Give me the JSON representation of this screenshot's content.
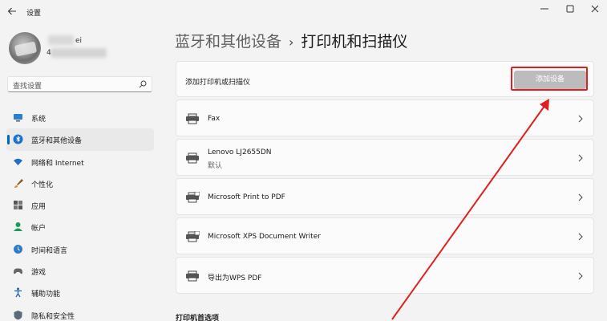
{
  "window": {
    "title": "设置",
    "back_icon": "arrow-left-icon",
    "minimize_icon": "minimize-icon",
    "maximize_icon": "maximize-icon",
    "close_icon": "close-icon"
  },
  "user": {
    "name_suffix": "ei",
    "email_prefix": "4"
  },
  "search": {
    "placeholder": "查找设置",
    "icon": "search-icon"
  },
  "nav": {
    "items": [
      {
        "label": "系统",
        "icon": "monitor-icon"
      },
      {
        "label": "蓝牙和其他设备",
        "icon": "bluetooth-icon"
      },
      {
        "label": "网络和 Internet",
        "icon": "wifi-icon"
      },
      {
        "label": "个性化",
        "icon": "brush-icon"
      },
      {
        "label": "应用",
        "icon": "apps-icon"
      },
      {
        "label": "帐户",
        "icon": "person-icon"
      },
      {
        "label": "时间和语言",
        "icon": "clock-globe-icon"
      },
      {
        "label": "游戏",
        "icon": "gamepad-icon"
      },
      {
        "label": "辅助功能",
        "icon": "accessibility-icon"
      },
      {
        "label": "隐私和安全性",
        "icon": "shield-icon"
      }
    ],
    "active_index": 1
  },
  "breadcrumb": {
    "parent": "蓝牙和其他设备",
    "separator": "›",
    "current": "打印机和扫描仪"
  },
  "add_device": {
    "label": "添加打印机或扫描仪",
    "button": "添加设备"
  },
  "printers": [
    {
      "name": "Fax",
      "status": ""
    },
    {
      "name": "Lenovo LJ2655DN",
      "status": "默认"
    },
    {
      "name": "Microsoft Print to PDF",
      "status": ""
    },
    {
      "name": "Microsoft XPS Document Writer",
      "status": ""
    },
    {
      "name": "导出为WPS PDF",
      "status": ""
    }
  ],
  "section_printer_prefs": "打印机首选项",
  "colors": {
    "accent": "#0067c0",
    "annotation_red": "#e02020",
    "button_disabled": "#bcbcbc"
  }
}
